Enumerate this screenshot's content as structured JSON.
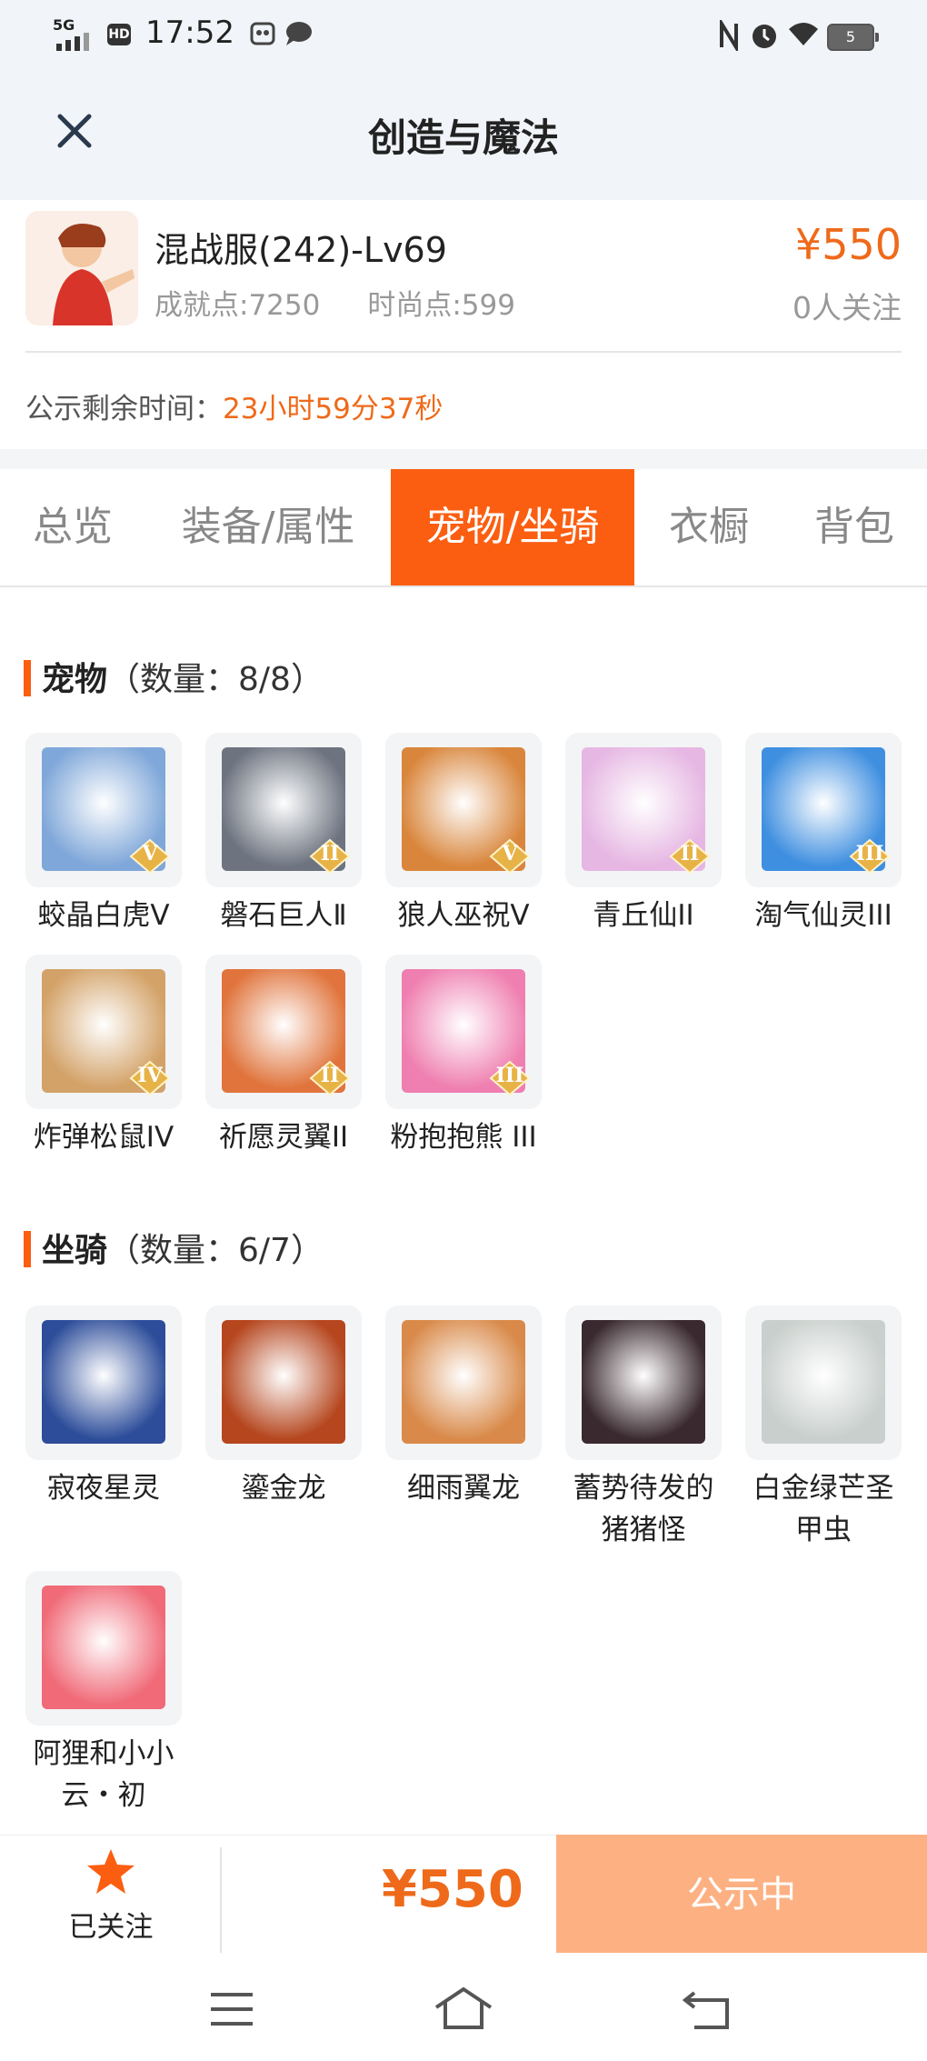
{
  "status": {
    "network": "5G",
    "hd": "HD",
    "time": "17:52",
    "battery": "5"
  },
  "header": {
    "title": "创造与魔法",
    "close_icon": "close-icon"
  },
  "listing": {
    "name": "混战服(242)-Lv69",
    "achievement": "成就点:7250",
    "fashion": "时尚点:599",
    "price": "¥550",
    "followers": "0人关注",
    "timer_label": "公示剩余时间：",
    "timer_value": "23小时59分37秒"
  },
  "tabs": [
    "总览",
    "装备/属性",
    "宠物/坐骑",
    "衣橱",
    "背包"
  ],
  "active_tab": 2,
  "pets": {
    "title": "宠物",
    "count": "（数量：8/8）",
    "items": [
      {
        "label": "蛟晶白虎Ⅴ",
        "rank": "V",
        "icon": "white-tiger-icon",
        "color": "#7fa7d9"
      },
      {
        "label": "磐石巨人Ⅱ",
        "rank": "II",
        "icon": "rock-giant-icon",
        "color": "#6d7480"
      },
      {
        "label": "狼人巫祝Ⅴ",
        "rank": "V",
        "icon": "werewolf-shaman-icon",
        "color": "#d9863c"
      },
      {
        "label": "青丘仙II",
        "rank": "II",
        "icon": "fox-fairy-icon",
        "color": "#e6b7e3"
      },
      {
        "label": "淘气仙灵III",
        "rank": "III",
        "icon": "naughty-sprite-icon",
        "color": "#3f8fe0"
      },
      {
        "label": "炸弹松鼠IV",
        "rank": "IV",
        "icon": "bomb-squirrel-icon",
        "color": "#d3a268"
      },
      {
        "label": "祈愿灵翼II",
        "rank": "II",
        "icon": "wish-wing-bird-icon",
        "color": "#e0743c"
      },
      {
        "label": "粉抱抱熊 III",
        "rank": "III",
        "icon": "pink-bear-icon",
        "color": "#ef7fb0"
      }
    ]
  },
  "mounts": {
    "title": "坐骑",
    "count": "（数量：6/7）",
    "items": [
      {
        "label": "寂夜星灵",
        "icon": "night-star-spirit-icon",
        "color": "#2d4d9a"
      },
      {
        "label": "鎏金龙",
        "icon": "gilded-dragon-icon",
        "color": "#b5461e"
      },
      {
        "label": "细雨翼龙",
        "icon": "drizzle-pterosaur-icon",
        "color": "#d98a4a"
      },
      {
        "label": "蓄势待发的猪猪怪",
        "icon": "pig-monster-icon",
        "color": "#3a2a30"
      },
      {
        "label": "白金绿芒圣甲虫",
        "icon": "platinum-scarab-icon",
        "color": "#c9cfcc"
      },
      {
        "label": "阿狸和小小云・初",
        "icon": "ali-cloud-icon",
        "color": "#f06a78"
      }
    ]
  },
  "bottom": {
    "fav_label": "已关注",
    "price": "¥550",
    "cta_label": "公示中"
  },
  "colors": {
    "accent": "#fb5e10",
    "price": "#ee6a1a",
    "cta": "#fdb183"
  }
}
